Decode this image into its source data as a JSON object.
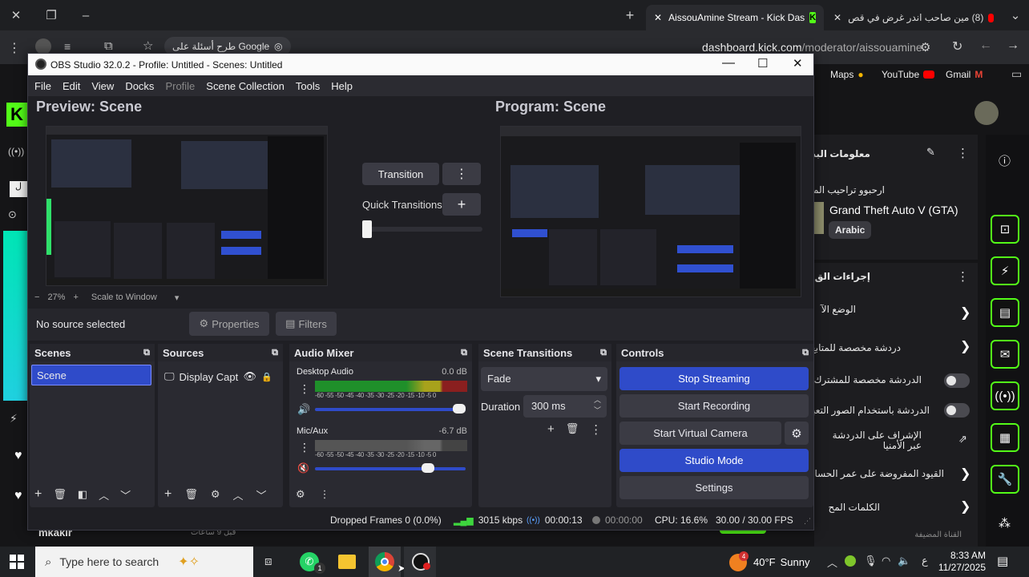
{
  "browser": {
    "tabs": [
      {
        "label": "AissouAmine Stream - Kick Das",
        "active": true
      },
      {
        "label": "(8) مين صاحب اندر غرض في قص",
        "active": false
      }
    ],
    "search_chip": "طرح أسئلة على Google",
    "url_host": "dashboard.kick.com",
    "url_path": "/moderator/aissouamine",
    "bookmarks": [
      "Maps",
      "YouTube",
      "Gmail"
    ]
  },
  "kick": {
    "stream_info_title": "معلومات البث",
    "stream_title": "ارحبوو تراحيب المطر",
    "game": "Grand Theft Auto V (GTA)",
    "language": "Arabic",
    "quick_actions_title": "إجراءات الق",
    "rows": [
      "الوضع الآ",
      "دردشة مخصصة للمتابع",
      "الدردشة مخصصة للمشترك",
      "الدردشة باستخدام الصور التعبير",
      "الإشراف على الدردشة عبر الأمنيا",
      "القيود المفروضة على عمر الحساب",
      "الكلمات المح"
    ],
    "footer": "القناة المضيفة",
    "chat_user": "mkakir",
    "chat_time": "قبل 9 ساعات",
    "accent": "#53fc18"
  },
  "obs": {
    "title": "OBS Studio 32.0.2 - Profile: Untitled - Scenes: Untitled",
    "menu": [
      "File",
      "Edit",
      "View",
      "Docks",
      "Profile",
      "Scene Collection",
      "Tools",
      "Help"
    ],
    "preview_label": "Preview: Scene",
    "program_label": "Program: Scene",
    "transition_label": "Transition",
    "quick_transitions_label": "Quick Transitions",
    "zoom": "27%",
    "scale_mode": "Scale to Window",
    "no_source": "No source selected",
    "properties_label": "Properties",
    "filters_label": "Filters",
    "docks": {
      "scenes": {
        "title": "Scenes",
        "items": [
          "Scene"
        ]
      },
      "sources": {
        "title": "Sources",
        "items": [
          "Display Captu"
        ]
      },
      "mixer": {
        "title": "Audio Mixer",
        "channels": [
          {
            "name": "Desktop Audio",
            "db": "0.0 dB",
            "level": 1.0,
            "muted": false
          },
          {
            "name": "Mic/Aux",
            "db": "-6.7 dB",
            "level": 0.79,
            "muted": true
          }
        ],
        "scale": "-60 -55 -50 -45 -40 -35 -30 -25 -20 -15 -10 -5 0"
      },
      "transitions": {
        "title": "Scene Transitions",
        "selected": "Fade",
        "duration_label": "Duration",
        "duration": "300 ms"
      },
      "controls": {
        "title": "Controls",
        "buttons": [
          "Stop Streaming",
          "Start Recording",
          "Start Virtual Camera",
          "Studio Mode",
          "Settings"
        ]
      }
    },
    "status": {
      "dropped": "Dropped Frames 0 (0.0%)",
      "bitrate": "3015 kbps",
      "stream_time": "00:00:13",
      "rec_time": "00:00:00",
      "cpu": "CPU: 16.6%",
      "fps": "30.00 / 30.00 FPS"
    }
  },
  "taskbar": {
    "search_placeholder": "Type here to search",
    "weather_temp": "40°F",
    "weather_text": "Sunny",
    "weather_badge": "4",
    "whatsapp_badge": "1",
    "lang": "ع",
    "time": "8:33 AM",
    "date": "11/27/2025"
  }
}
